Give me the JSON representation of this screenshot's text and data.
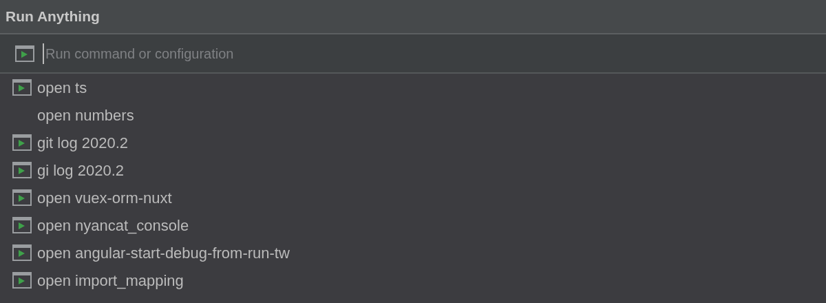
{
  "window": {
    "title": "Run Anything"
  },
  "search": {
    "placeholder": "Run command or configuration"
  },
  "items": [
    {
      "label": "open ts",
      "kind": "config"
    },
    {
      "label": "open numbers",
      "kind": "plain"
    },
    {
      "label": "git log 2020.2",
      "kind": "config"
    },
    {
      "label": "gi log 2020.2",
      "kind": "config"
    },
    {
      "label": "open vuex-orm-nuxt",
      "kind": "config"
    },
    {
      "label": "open nyancat_console",
      "kind": "config"
    },
    {
      "label": "open angular-start-debug-from-run-tw",
      "kind": "config"
    },
    {
      "label": "open import_mapping",
      "kind": "config"
    }
  ]
}
